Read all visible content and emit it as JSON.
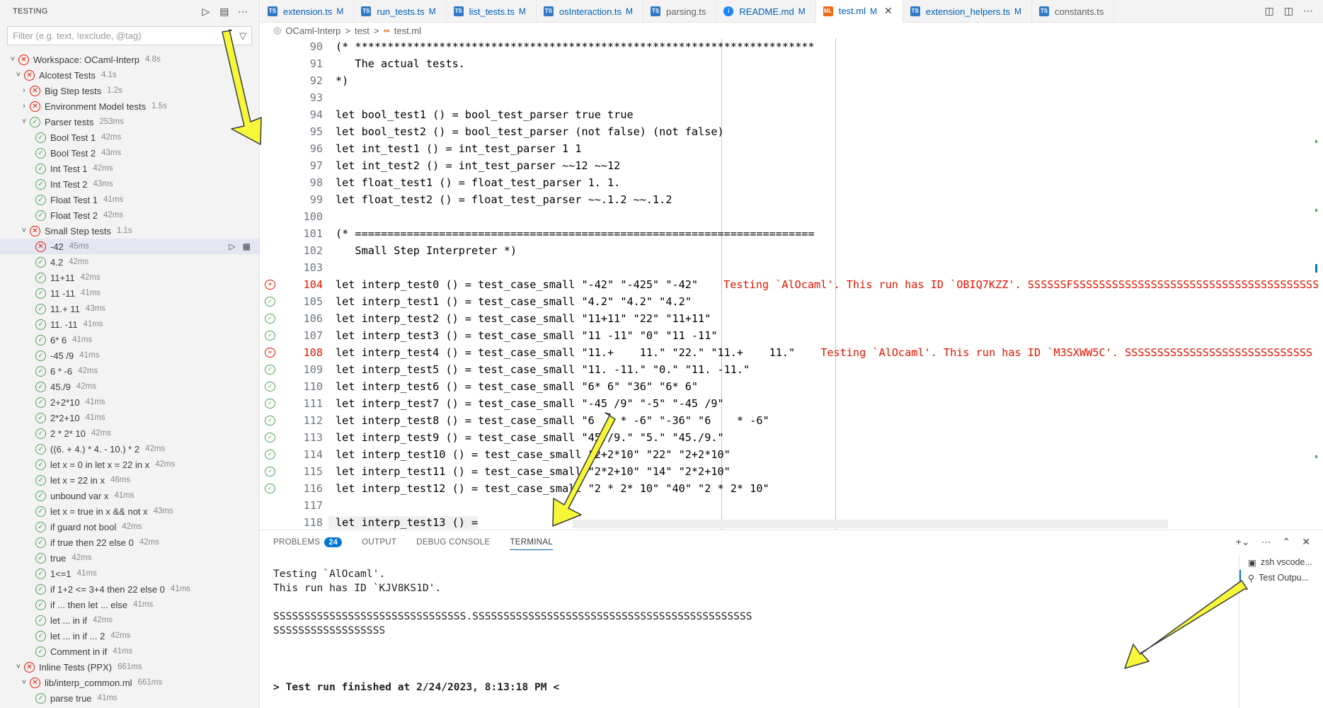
{
  "sidebar": {
    "title": "TESTING",
    "filter_placeholder": "Filter (e.g. text, !exclude, @tag)",
    "items": [
      {
        "label": "Workspace: OCaml-Interp",
        "duration": "4.8s"
      },
      {
        "label": "Alcotest Tests",
        "duration": "4.1s"
      },
      {
        "label": "Big Step tests",
        "duration": "1.2s"
      },
      {
        "label": "Environment Model tests",
        "duration": "1.5s"
      },
      {
        "label": "Parser tests",
        "duration": "253ms"
      },
      {
        "label": "Bool Test 1",
        "duration": "42ms"
      },
      {
        "label": "Bool Test 2",
        "duration": "43ms"
      },
      {
        "label": "Int Test 1",
        "duration": "42ms"
      },
      {
        "label": "Int Test 2",
        "duration": "43ms"
      },
      {
        "label": "Float Test 1",
        "duration": "41ms"
      },
      {
        "label": "Float Test 2",
        "duration": "42ms"
      },
      {
        "label": "Small Step tests",
        "duration": "1.1s"
      },
      {
        "label": "-42",
        "duration": "45ms"
      },
      {
        "label": "4.2",
        "duration": "42ms"
      },
      {
        "label": "11+11",
        "duration": "42ms"
      },
      {
        "label": "11 -11",
        "duration": "41ms"
      },
      {
        "label": "11.+ 11",
        "duration": "43ms"
      },
      {
        "label": "11. -11",
        "duration": "41ms"
      },
      {
        "label": "6* 6",
        "duration": "41ms"
      },
      {
        "label": "-45 /9",
        "duration": "41ms"
      },
      {
        "label": "6 * -6",
        "duration": "42ms"
      },
      {
        "label": "45./9",
        "duration": "42ms"
      },
      {
        "label": "2+2*10",
        "duration": "41ms"
      },
      {
        "label": "2*2+10",
        "duration": "41ms"
      },
      {
        "label": "2 * 2* 10",
        "duration": "42ms"
      },
      {
        "label": "((6. + 4.) * 4. - 10.) * 2",
        "duration": "42ms"
      },
      {
        "label": "let x = 0 in let x = 22 in x",
        "duration": "42ms"
      },
      {
        "label": "let x = 22 in x",
        "duration": "46ms"
      },
      {
        "label": "unbound var x",
        "duration": "41ms"
      },
      {
        "label": "let x = true in x && not x",
        "duration": "43ms"
      },
      {
        "label": "if guard not bool",
        "duration": "42ms"
      },
      {
        "label": "if true then 22 else 0",
        "duration": "42ms"
      },
      {
        "label": "true",
        "duration": "42ms"
      },
      {
        "label": "1<=1",
        "duration": "41ms"
      },
      {
        "label": "if 1+2 <= 3+4 then 22 else 0",
        "duration": "41ms"
      },
      {
        "label": "if ... then let ... else",
        "duration": "41ms"
      },
      {
        "label": "let ... in if",
        "duration": "42ms"
      },
      {
        "label": "let ... in if ... 2",
        "duration": "42ms"
      },
      {
        "label": "Comment in if",
        "duration": "41ms"
      },
      {
        "label": "Inline Tests (PPX)",
        "duration": "661ms"
      },
      {
        "label": "lib/interp_common.ml",
        "duration": "661ms"
      },
      {
        "label": "parse true",
        "duration": "41ms"
      }
    ]
  },
  "tabs": [
    {
      "label": "extension.ts",
      "badge": "M",
      "icon": "TS"
    },
    {
      "label": "run_tests.ts",
      "badge": "M",
      "icon": "TS"
    },
    {
      "label": "list_tests.ts",
      "badge": "M",
      "icon": "TS"
    },
    {
      "label": "osInteraction.ts",
      "badge": "M",
      "icon": "TS"
    },
    {
      "label": "parsing.ts",
      "badge": "",
      "icon": "TS"
    },
    {
      "label": "README.md",
      "badge": "M",
      "icon": "i"
    },
    {
      "label": "test.ml",
      "badge": "M",
      "icon": "ML"
    },
    {
      "label": "extension_helpers.ts",
      "badge": "M",
      "icon": "TS"
    },
    {
      "label": "constants.ts",
      "badge": "",
      "icon": "TS"
    }
  ],
  "breadcrumb": {
    "root": "OCaml-Interp",
    "sep1": ">",
    "folder": "test",
    "sep2": ">",
    "file": "test.ml"
  },
  "code": [
    {
      "n": "90",
      "t": "(* ***********************************************************************"
    },
    {
      "n": "91",
      "t": "   The actual tests."
    },
    {
      "n": "92",
      "t": "*)"
    },
    {
      "n": "93",
      "t": ""
    },
    {
      "n": "94",
      "t": "let bool_test1 () = bool_test_parser true true"
    },
    {
      "n": "95",
      "t": "let bool_test2 () = bool_test_parser (not false) (not false)"
    },
    {
      "n": "96",
      "t": "let int_test1 () = int_test_parser 1 1"
    },
    {
      "n": "97",
      "t": "let int_test2 () = int_test_parser ~~12 ~~12"
    },
    {
      "n": "98",
      "t": "let float_test1 () = float_test_parser 1. 1."
    },
    {
      "n": "99",
      "t": "let float_test2 () = float_test_parser ~~.1.2 ~~.1.2"
    },
    {
      "n": "100",
      "t": ""
    },
    {
      "n": "101",
      "t": "(* ======================================================================="
    },
    {
      "n": "102",
      "t": "   Small Step Interpreter *)"
    },
    {
      "n": "103",
      "t": ""
    },
    {
      "n": "104",
      "t": "let interp_test0 () = test_case_small \"-42\" \"-425\" \"-42\"",
      "err": "Testing `AlOcaml'. This run has ID `OBIQ7KZZ'. SSSSSSFSSSSSSSSSSSSSSSSSSSSSSSSSSSSSSSSSSSSSS"
    },
    {
      "n": "105",
      "t": "let interp_test1 () = test_case_small \"4.2\" \"4.2\" \"4.2\""
    },
    {
      "n": "106",
      "t": "let interp_test2 () = test_case_small \"11+11\" \"22\" \"11+11\""
    },
    {
      "n": "107",
      "t": "let interp_test3 () = test_case_small \"11 -11\" \"0\" \"11 -11\""
    },
    {
      "n": "108",
      "t": "let interp_test4 () = test_case_small \"11.+    11.\" \"22.\" \"11.+    11.\"",
      "err": "Testing `AlOcaml'. This run has ID `M3SXWW5C'. SSSSSSSSSSSSSSSSSSSSSSSSSSSSS"
    },
    {
      "n": "109",
      "t": "let interp_test5 () = test_case_small \"11. -11.\" \"0.\" \"11. -11.\""
    },
    {
      "n": "110",
      "t": "let interp_test6 () = test_case_small \"6* 6\" \"36\" \"6* 6\""
    },
    {
      "n": "111",
      "t": "let interp_test7 () = test_case_small \"-45 /9\" \"-5\" \"-45 /9\""
    },
    {
      "n": "112",
      "t": "let interp_test8 () = test_case_small \"6    * -6\" \"-36\" \"6    * -6\""
    },
    {
      "n": "113",
      "t": "let interp_test9 () = test_case_small \"45./9.\" \"5.\" \"45./9.\""
    },
    {
      "n": "114",
      "t": "let interp_test10 () = test_case_small \"2+2*10\" \"22\" \"2+2*10\""
    },
    {
      "n": "115",
      "t": "let interp_test11 () = test_case_small \"2*2+10\" \"14\" \"2*2+10\""
    },
    {
      "n": "116",
      "t": "let interp_test12 () = test_case_small \"2 * 2* 10\" \"40\" \"2 * 2* 10\""
    },
    {
      "n": "117",
      "t": ""
    },
    {
      "n": "118",
      "t": "let interp_test13 () ="
    }
  ],
  "panel": {
    "tabs": [
      "PROBLEMS",
      "OUTPUT",
      "DEBUG CONSOLE",
      "TERMINAL"
    ],
    "problems_count": "24",
    "terminal_lines": [
      "Testing `AlOcaml'.",
      "This run has ID `KJV8KS1D'.",
      "",
      "SSSSSSSSSSSSSSSSSSSSSSSSSSSSSSS.SSSSSSSSSSSSSSSSSSSSSSSSSSSSSSSSSSSSSSSSSSSSS",
      "SSSSSSSSSSSSSSSSSS",
      "",
      "",
      ""
    ],
    "finished": "> Test run finished at 2/24/2023, 8:13:18 PM <",
    "terminal_list": [
      "zsh  vscode...",
      "Test Outpu..."
    ]
  },
  "colors": {
    "fail": "#e51400",
    "pass": "#4da35a",
    "accent": "#005fb8",
    "arrow": "#f7f73a"
  }
}
